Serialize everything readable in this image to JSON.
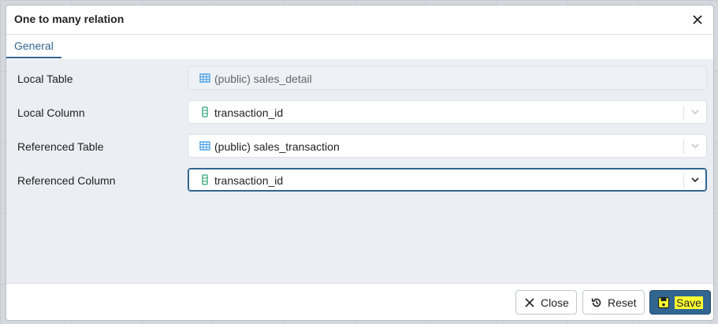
{
  "dialog": {
    "title": "One to many relation",
    "tabs": [
      {
        "label": "General"
      }
    ]
  },
  "form": {
    "rows": [
      {
        "label": "Local Table",
        "value": "(public) sales_detail",
        "icon": "table-icon"
      },
      {
        "label": "Local Column",
        "value": "transaction_id",
        "icon": "column-icon"
      },
      {
        "label": "Referenced Table",
        "value": "(public) sales_transaction",
        "icon": "table-icon"
      },
      {
        "label": "Referenced Column",
        "value": "transaction_id",
        "icon": "column-icon"
      }
    ]
  },
  "footer": {
    "close_label": "Close",
    "reset_label": "Reset",
    "save_label": "Save"
  },
  "colors": {
    "accent": "#326690",
    "save_highlight": "#ffff33",
    "body_bg": "#ebeef3",
    "column_icon": "#2fa87a",
    "table_icon": "#3d9be3"
  }
}
